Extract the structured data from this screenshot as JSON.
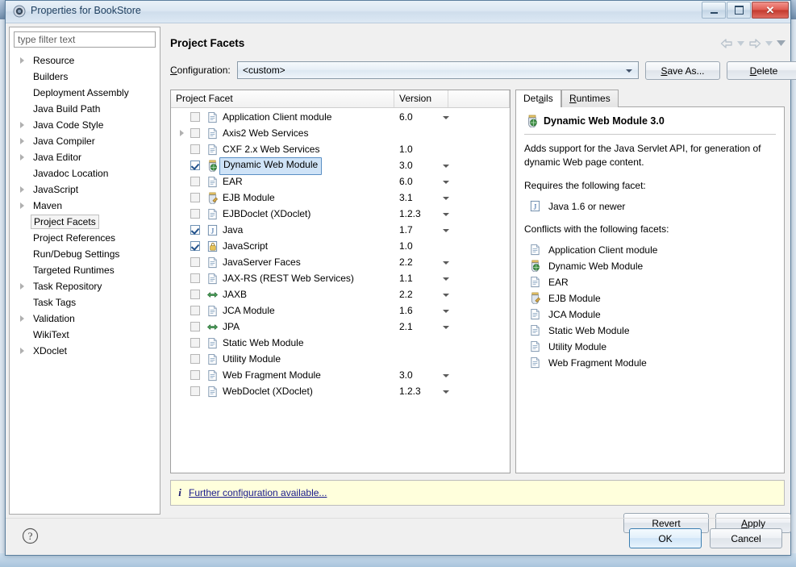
{
  "window": {
    "title": "Properties for BookStore",
    "icon": "properties-icon",
    "minimize_label": "Minimize",
    "maximize_label": "Maximize",
    "close_label": "✕"
  },
  "sidebar": {
    "filter_placeholder": "type filter text",
    "filter_value": "",
    "items": [
      {
        "label": "Resource",
        "expandable": true,
        "selected": false
      },
      {
        "label": "Builders",
        "expandable": false,
        "selected": false
      },
      {
        "label": "Deployment Assembly",
        "expandable": false,
        "selected": false
      },
      {
        "label": "Java Build Path",
        "expandable": false,
        "selected": false
      },
      {
        "label": "Java Code Style",
        "expandable": true,
        "selected": false
      },
      {
        "label": "Java Compiler",
        "expandable": true,
        "selected": false
      },
      {
        "label": "Java Editor",
        "expandable": true,
        "selected": false
      },
      {
        "label": "Javadoc Location",
        "expandable": false,
        "selected": false
      },
      {
        "label": "JavaScript",
        "expandable": true,
        "selected": false
      },
      {
        "label": "Maven",
        "expandable": true,
        "selected": false
      },
      {
        "label": "Project Facets",
        "expandable": false,
        "selected": true
      },
      {
        "label": "Project References",
        "expandable": false,
        "selected": false
      },
      {
        "label": "Run/Debug Settings",
        "expandable": false,
        "selected": false
      },
      {
        "label": "Targeted Runtimes",
        "expandable": false,
        "selected": false
      },
      {
        "label": "Task Repository",
        "expandable": true,
        "selected": false
      },
      {
        "label": "Task Tags",
        "expandable": false,
        "selected": false
      },
      {
        "label": "Validation",
        "expandable": true,
        "selected": false
      },
      {
        "label": "WikiText",
        "expandable": false,
        "selected": false
      },
      {
        "label": "XDoclet",
        "expandable": true,
        "selected": false
      }
    ]
  },
  "page": {
    "title": "Project Facets",
    "nav": {
      "back_icon": "back-arrow-icon",
      "back_menu_icon": "chevron-down-icon",
      "forward_icon": "forward-arrow-icon",
      "forward_menu_icon": "chevron-down-icon",
      "overflow_icon": "chevron-down-icon"
    }
  },
  "configuration": {
    "label": "Configuration:",
    "label_mnemonic": "C",
    "value": "<custom>",
    "save_as_label": "Save As...",
    "save_as_mnemonic": "S",
    "delete_label": "Delete",
    "delete_mnemonic": "D"
  },
  "facet_table": {
    "columns": [
      "Project Facet",
      "Version",
      ""
    ],
    "rows": [
      {
        "name": "Application Client module",
        "version": "6.0",
        "checked": false,
        "expandable": false,
        "has_version_menu": true,
        "icon": "doc-icon",
        "selected": false
      },
      {
        "name": "Axis2 Web Services",
        "version": "",
        "checked": false,
        "expandable": true,
        "has_version_menu": false,
        "icon": "doc-icon",
        "selected": false
      },
      {
        "name": "CXF 2.x Web Services",
        "version": "1.0",
        "checked": false,
        "expandable": false,
        "has_version_menu": false,
        "icon": "doc-icon",
        "selected": false
      },
      {
        "name": "Dynamic Web Module",
        "version": "3.0",
        "checked": true,
        "expandable": false,
        "has_version_menu": true,
        "icon": "web-jar-icon",
        "selected": true
      },
      {
        "name": "EAR",
        "version": "6.0",
        "checked": false,
        "expandable": false,
        "has_version_menu": true,
        "icon": "doc-icon",
        "selected": false
      },
      {
        "name": "EJB Module",
        "version": "3.1",
        "checked": false,
        "expandable": false,
        "has_version_menu": true,
        "icon": "ejb-jar-icon",
        "selected": false
      },
      {
        "name": "EJBDoclet (XDoclet)",
        "version": "1.2.3",
        "checked": false,
        "expandable": false,
        "has_version_menu": true,
        "icon": "doc-icon",
        "selected": false
      },
      {
        "name": "Java",
        "version": "1.7",
        "checked": true,
        "expandable": false,
        "has_version_menu": true,
        "icon": "java-icon",
        "selected": false
      },
      {
        "name": "JavaScript",
        "version": "1.0",
        "checked": true,
        "expandable": false,
        "has_version_menu": false,
        "icon": "js-icon",
        "selected": false
      },
      {
        "name": "JavaServer Faces",
        "version": "2.2",
        "checked": false,
        "expandable": false,
        "has_version_menu": true,
        "icon": "doc-icon",
        "selected": false
      },
      {
        "name": "JAX-RS (REST Web Services)",
        "version": "1.1",
        "checked": false,
        "expandable": false,
        "has_version_menu": true,
        "icon": "doc-icon",
        "selected": false
      },
      {
        "name": "JAXB",
        "version": "2.2",
        "checked": false,
        "expandable": false,
        "has_version_menu": true,
        "icon": "xb-icon",
        "selected": false
      },
      {
        "name": "JCA Module",
        "version": "1.6",
        "checked": false,
        "expandable": false,
        "has_version_menu": true,
        "icon": "doc-icon",
        "selected": false
      },
      {
        "name": "JPA",
        "version": "2.1",
        "checked": false,
        "expandable": false,
        "has_version_menu": true,
        "icon": "xb-icon",
        "selected": false
      },
      {
        "name": "Static Web Module",
        "version": "",
        "checked": false,
        "expandable": false,
        "has_version_menu": false,
        "icon": "doc-icon",
        "selected": false
      },
      {
        "name": "Utility Module",
        "version": "",
        "checked": false,
        "expandable": false,
        "has_version_menu": false,
        "icon": "doc-icon",
        "selected": false
      },
      {
        "name": "Web Fragment Module",
        "version": "3.0",
        "checked": false,
        "expandable": false,
        "has_version_menu": true,
        "icon": "doc-icon",
        "selected": false
      },
      {
        "name": "WebDoclet (XDoclet)",
        "version": "1.2.3",
        "checked": false,
        "expandable": false,
        "has_version_menu": true,
        "icon": "doc-icon",
        "selected": false
      }
    ]
  },
  "details": {
    "tabs": [
      {
        "label": "Details",
        "mnemonic": "a",
        "active": true
      },
      {
        "label": "Runtimes",
        "mnemonic": "R",
        "active": false
      }
    ],
    "title": "Dynamic Web Module 3.0",
    "title_icon": "web-jar-icon",
    "description": "Adds support for the Java Servlet API, for generation of dynamic Web page content.",
    "requires_heading": "Requires the following facet:",
    "requires": [
      {
        "label": "Java 1.6 or newer",
        "icon": "java-icon"
      }
    ],
    "conflicts_heading": "Conflicts with the following facets:",
    "conflicts": [
      {
        "label": "Application Client module",
        "icon": "doc-icon"
      },
      {
        "label": "Dynamic Web Module",
        "icon": "web-jar-icon"
      },
      {
        "label": "EAR",
        "icon": "doc-icon"
      },
      {
        "label": "EJB Module",
        "icon": "ejb-jar-icon"
      },
      {
        "label": "JCA Module",
        "icon": "doc-icon"
      },
      {
        "label": "Static Web Module",
        "icon": "doc-icon"
      },
      {
        "label": "Utility Module",
        "icon": "doc-icon"
      },
      {
        "label": "Web Fragment Module",
        "icon": "doc-icon"
      }
    ]
  },
  "infobar": {
    "icon": "info-icon",
    "link_text": "Further configuration available..."
  },
  "buttons": {
    "revert": "Revert",
    "apply": "Apply",
    "apply_mnemonic": "A",
    "ok": "OK",
    "cancel": "Cancel",
    "help_icon": "help-question-icon"
  },
  "colors": {
    "selection_blue": "#cfe3f7",
    "selection_border": "#5a8fc4",
    "info_background": "#ffffdc",
    "link": "#1a1a8c",
    "title_text": "#1c3d5e"
  }
}
